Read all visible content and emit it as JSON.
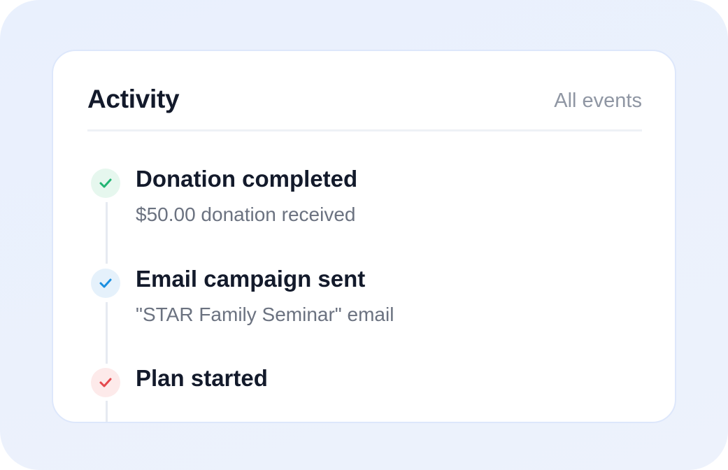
{
  "header": {
    "title": "Activity",
    "link_label": "All events"
  },
  "events": [
    {
      "title": "Donation completed",
      "subtitle": "$50.00 donation received",
      "icon": "check-icon",
      "icon_color": "#22b573",
      "icon_bg": "#e6f7ee"
    },
    {
      "title": "Email campaign sent",
      "subtitle": "\"STAR Family Seminar\" email",
      "icon": "check-icon",
      "icon_color": "#1a8fe0",
      "icon_bg": "#e5f1fb"
    },
    {
      "title": "Plan started",
      "subtitle": "",
      "icon": "check-icon",
      "icon_color": "#e5484d",
      "icon_bg": "#fdeaea"
    }
  ]
}
